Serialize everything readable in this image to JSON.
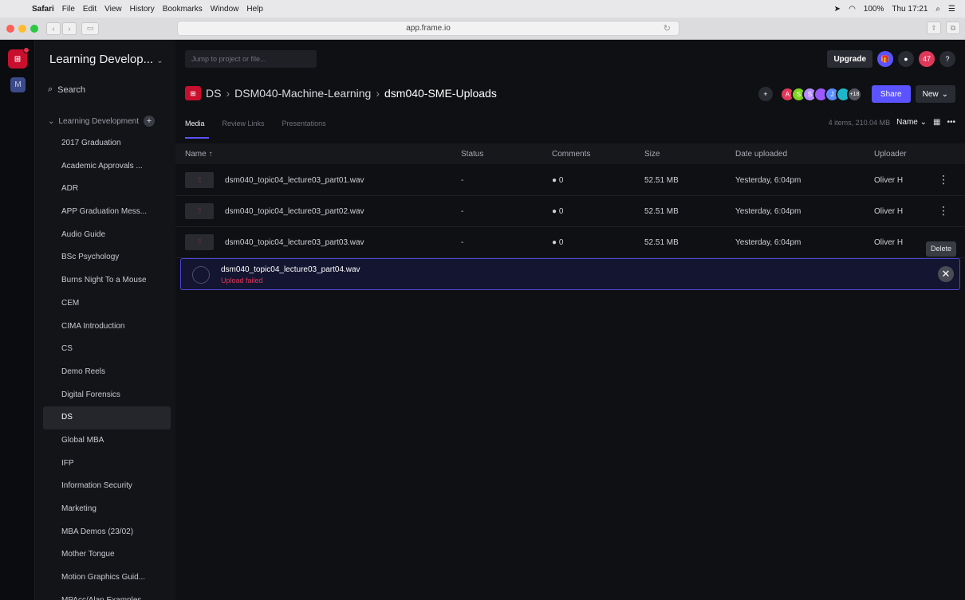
{
  "menubar": {
    "app": "Safari",
    "items": [
      "File",
      "Edit",
      "View",
      "History",
      "Bookmarks",
      "Window",
      "Help"
    ],
    "battery": "100%",
    "clock": "Thu 17:21"
  },
  "browser": {
    "url": "app.frame.io"
  },
  "rail": {
    "workspace_initial": "M"
  },
  "sidebar": {
    "team_name": "Learning Develop...",
    "search_label": "Search",
    "project": "Learning Development",
    "folders": [
      "2017 Graduation",
      "Academic Approvals ...",
      "ADR",
      "APP Graduation Mess...",
      "Audio Guide",
      "BSc Psychology",
      "Burns Night To a Mouse",
      "CEM",
      "CIMA Introduction",
      "CS",
      "Demo Reels",
      "Digital Forensics",
      "DS",
      "Global MBA",
      "IFP",
      "Information Security",
      "Marketing",
      "MBA Demos (23/02)",
      "Mother Tongue",
      "Motion Graphics Guid...",
      "MPAcc/Alan Examples"
    ],
    "active_folder": "DS"
  },
  "header": {
    "jump_placeholder": "Jump to project or file...",
    "upgrade": "Upgrade",
    "notifications": "47",
    "help": "?"
  },
  "breadcrumb": {
    "root": "DS",
    "parent": "DSM040-Machine-Learning",
    "current": "dsm040-SME-Uploads"
  },
  "collaborators": {
    "initials": [
      "A",
      "S",
      "S",
      "J",
      "J"
    ],
    "colors": [
      "#e0385a",
      "#7ed321",
      "#b58cff",
      "#9b59ff",
      "#5b8dff"
    ],
    "more": "+18",
    "share": "Share",
    "new": "New"
  },
  "tabs": [
    "Media",
    "Review Links",
    "Presentations"
  ],
  "summary": "4 items, 210.04 MB",
  "sort": "Name",
  "table": {
    "headers": {
      "name": "Name ↑",
      "status": "Status",
      "comments": "Comments",
      "size": "Size",
      "date": "Date uploaded",
      "uploader": "Uploader"
    },
    "rows": [
      {
        "name": "dsm040_topic04_lecture03_part01.wav",
        "status": "-",
        "comments": "0",
        "size": "52.51 MB",
        "date": "Yesterday, 6:04pm",
        "uploader": "Oliver H"
      },
      {
        "name": "dsm040_topic04_lecture03_part02.wav",
        "status": "-",
        "comments": "0",
        "size": "52.51 MB",
        "date": "Yesterday, 6:04pm",
        "uploader": "Oliver H"
      },
      {
        "name": "dsm040_topic04_lecture03_part03.wav",
        "status": "-",
        "comments": "0",
        "size": "52.51 MB",
        "date": "Yesterday, 6:04pm",
        "uploader": "Oliver H"
      }
    ],
    "failed": {
      "name": "dsm040_topic04_lecture03_part04.wav",
      "status": "Upload failed"
    }
  },
  "tooltip": "Delete"
}
